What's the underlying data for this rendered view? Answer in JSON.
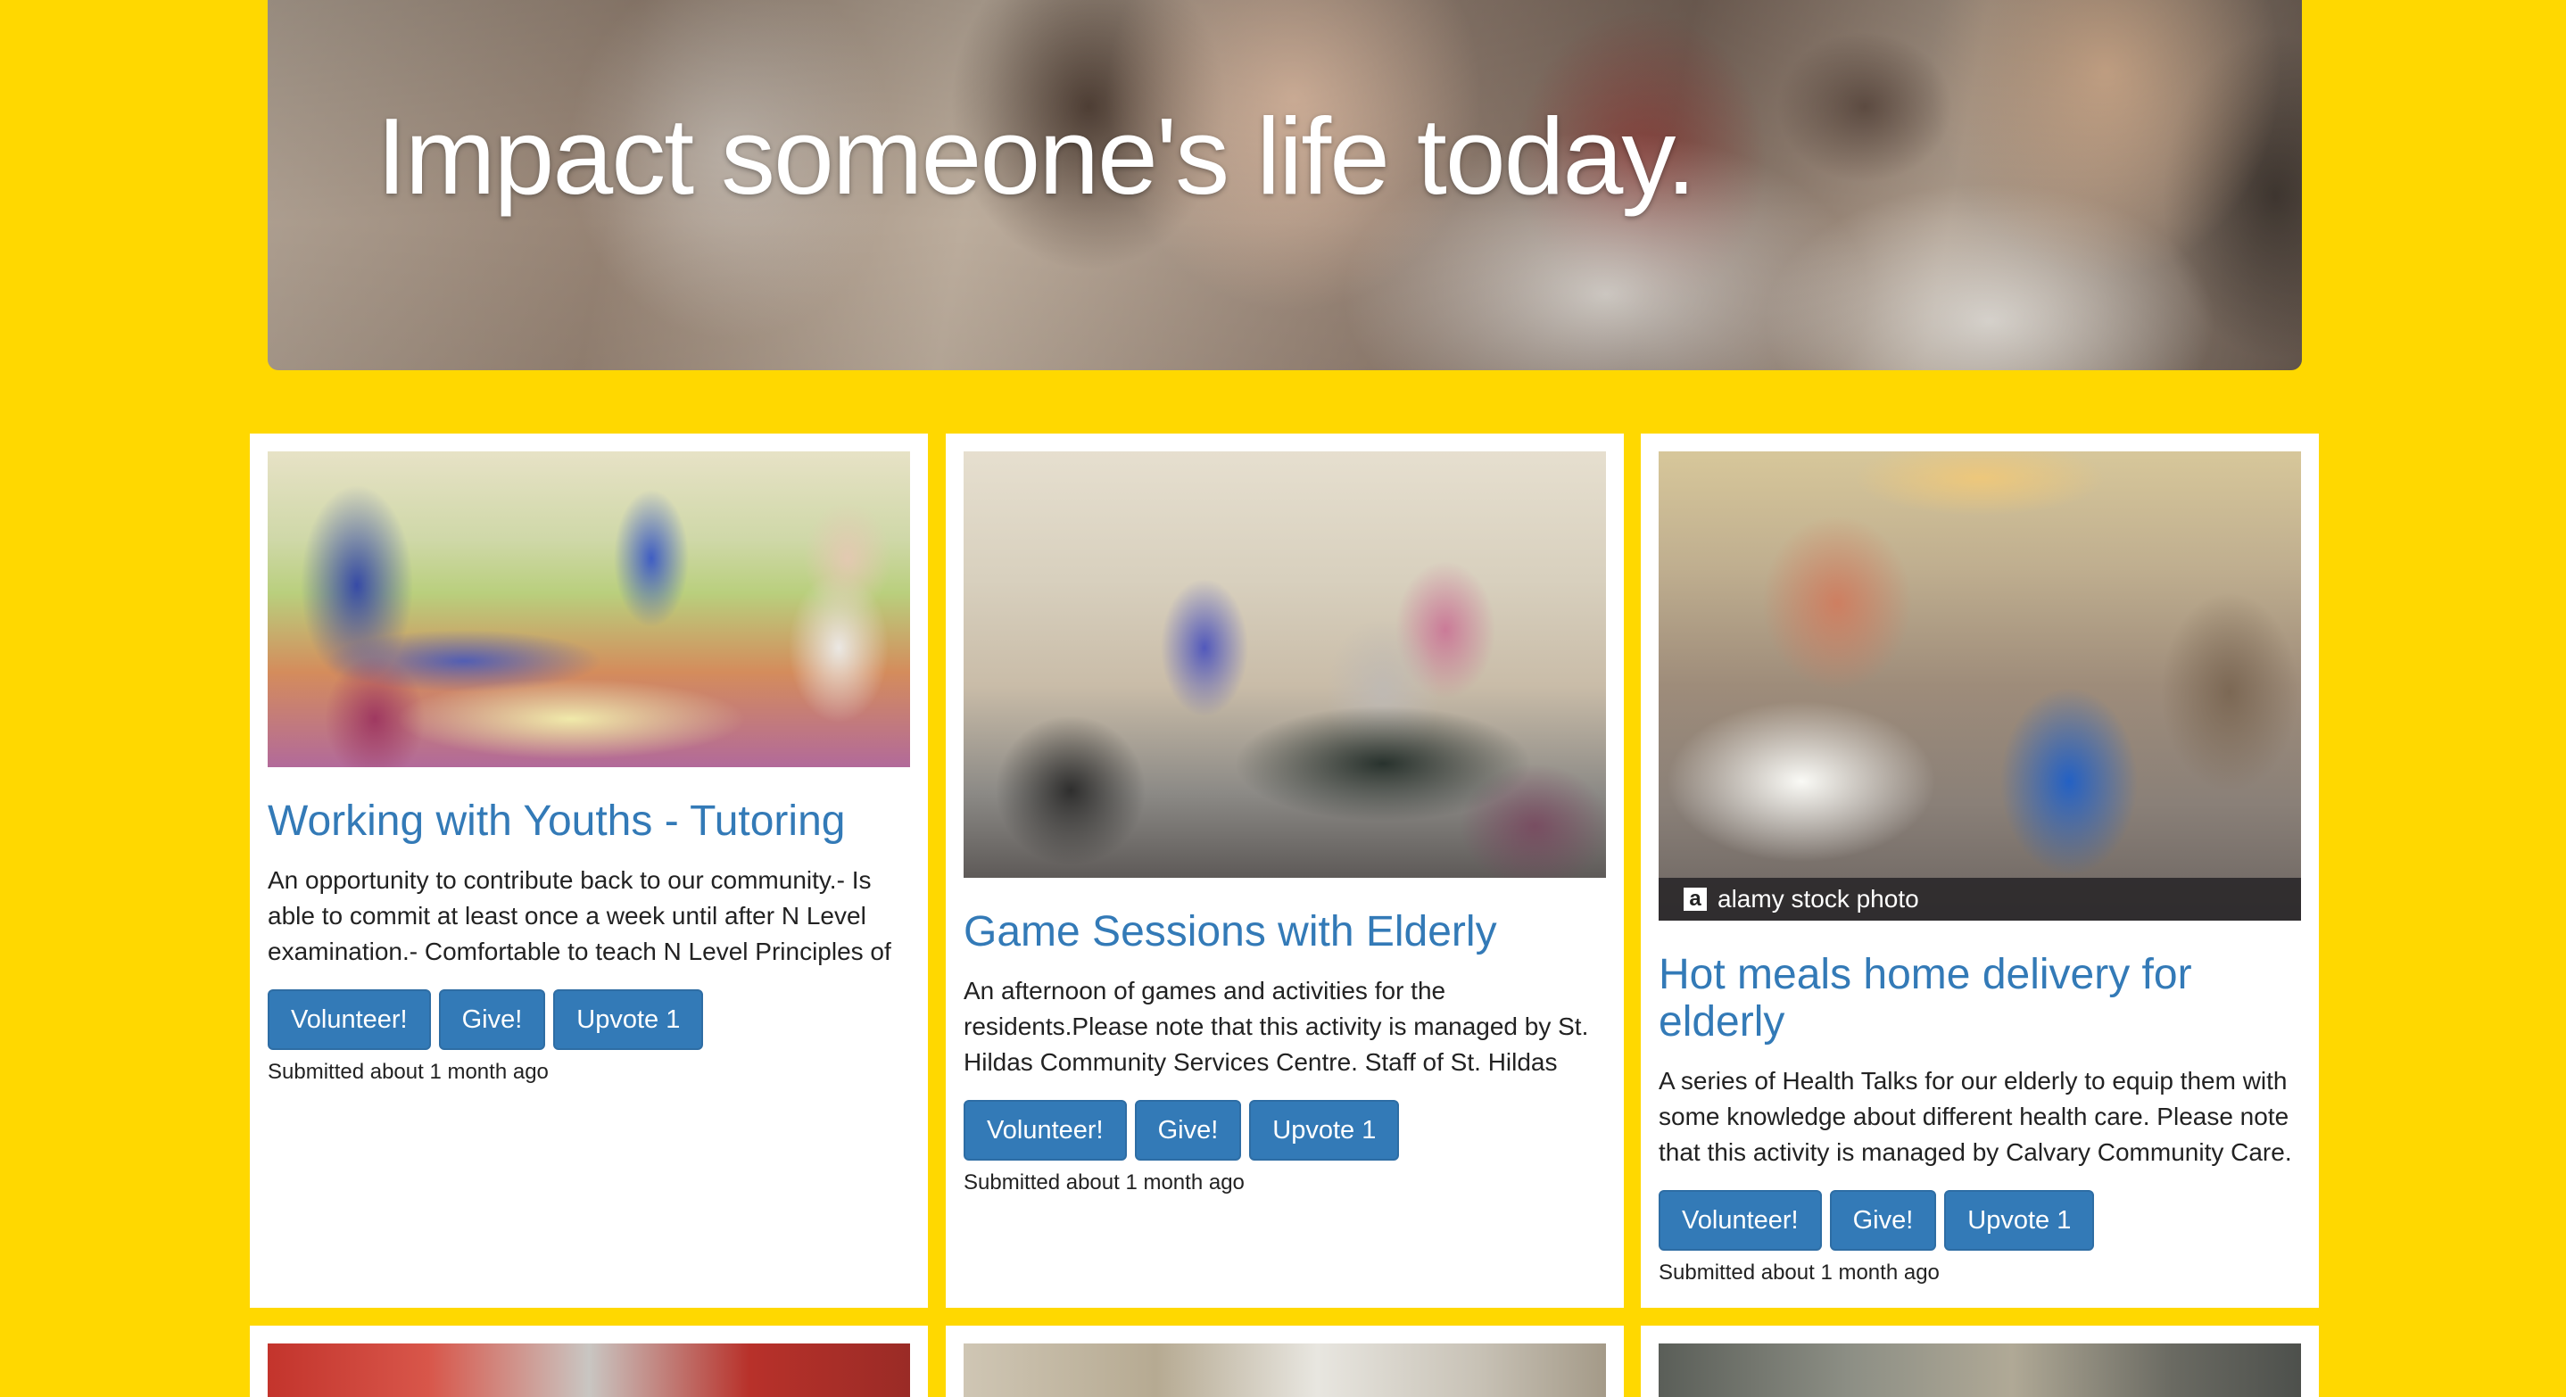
{
  "hero": {
    "headline": "Impact someone's life today."
  },
  "cards": [
    {
      "title": "Working with Youths - Tutoring",
      "description": "An opportunity to contribute back to our community.- Is able to commit at least once a week until after N Level examination.- Comfortable to teach N Level Principles of",
      "volunteer_label": "Volunteer!",
      "give_label": "Give!",
      "upvote_label": "Upvote 1",
      "submitted": "Submitted about 1 month ago"
    },
    {
      "title": "Game Sessions with Elderly",
      "description": "An afternoon of games and activities for the residents.Please note that this activity is managed by St. Hildas Community Services Centre. Staff of St. Hildas",
      "volunteer_label": "Volunteer!",
      "give_label": "Give!",
      "upvote_label": "Upvote 1",
      "submitted": "Submitted about 1 month ago"
    },
    {
      "title": "Hot meals home delivery for elderly",
      "description": "A series of Health Talks for our elderly to equip them with some knowledge about different health care. Please note that this activity is managed by Calvary Community Care.",
      "photo_credit_logo": "a",
      "photo_credit": "alamy stock photo",
      "volunteer_label": "Volunteer!",
      "give_label": "Give!",
      "upvote_label": "Upvote 1",
      "submitted": "Submitted about 1 month ago"
    }
  ],
  "colors": {
    "page_background": "#ffd800",
    "title_link": "#337ab7",
    "button_primary": "#337ab7"
  }
}
